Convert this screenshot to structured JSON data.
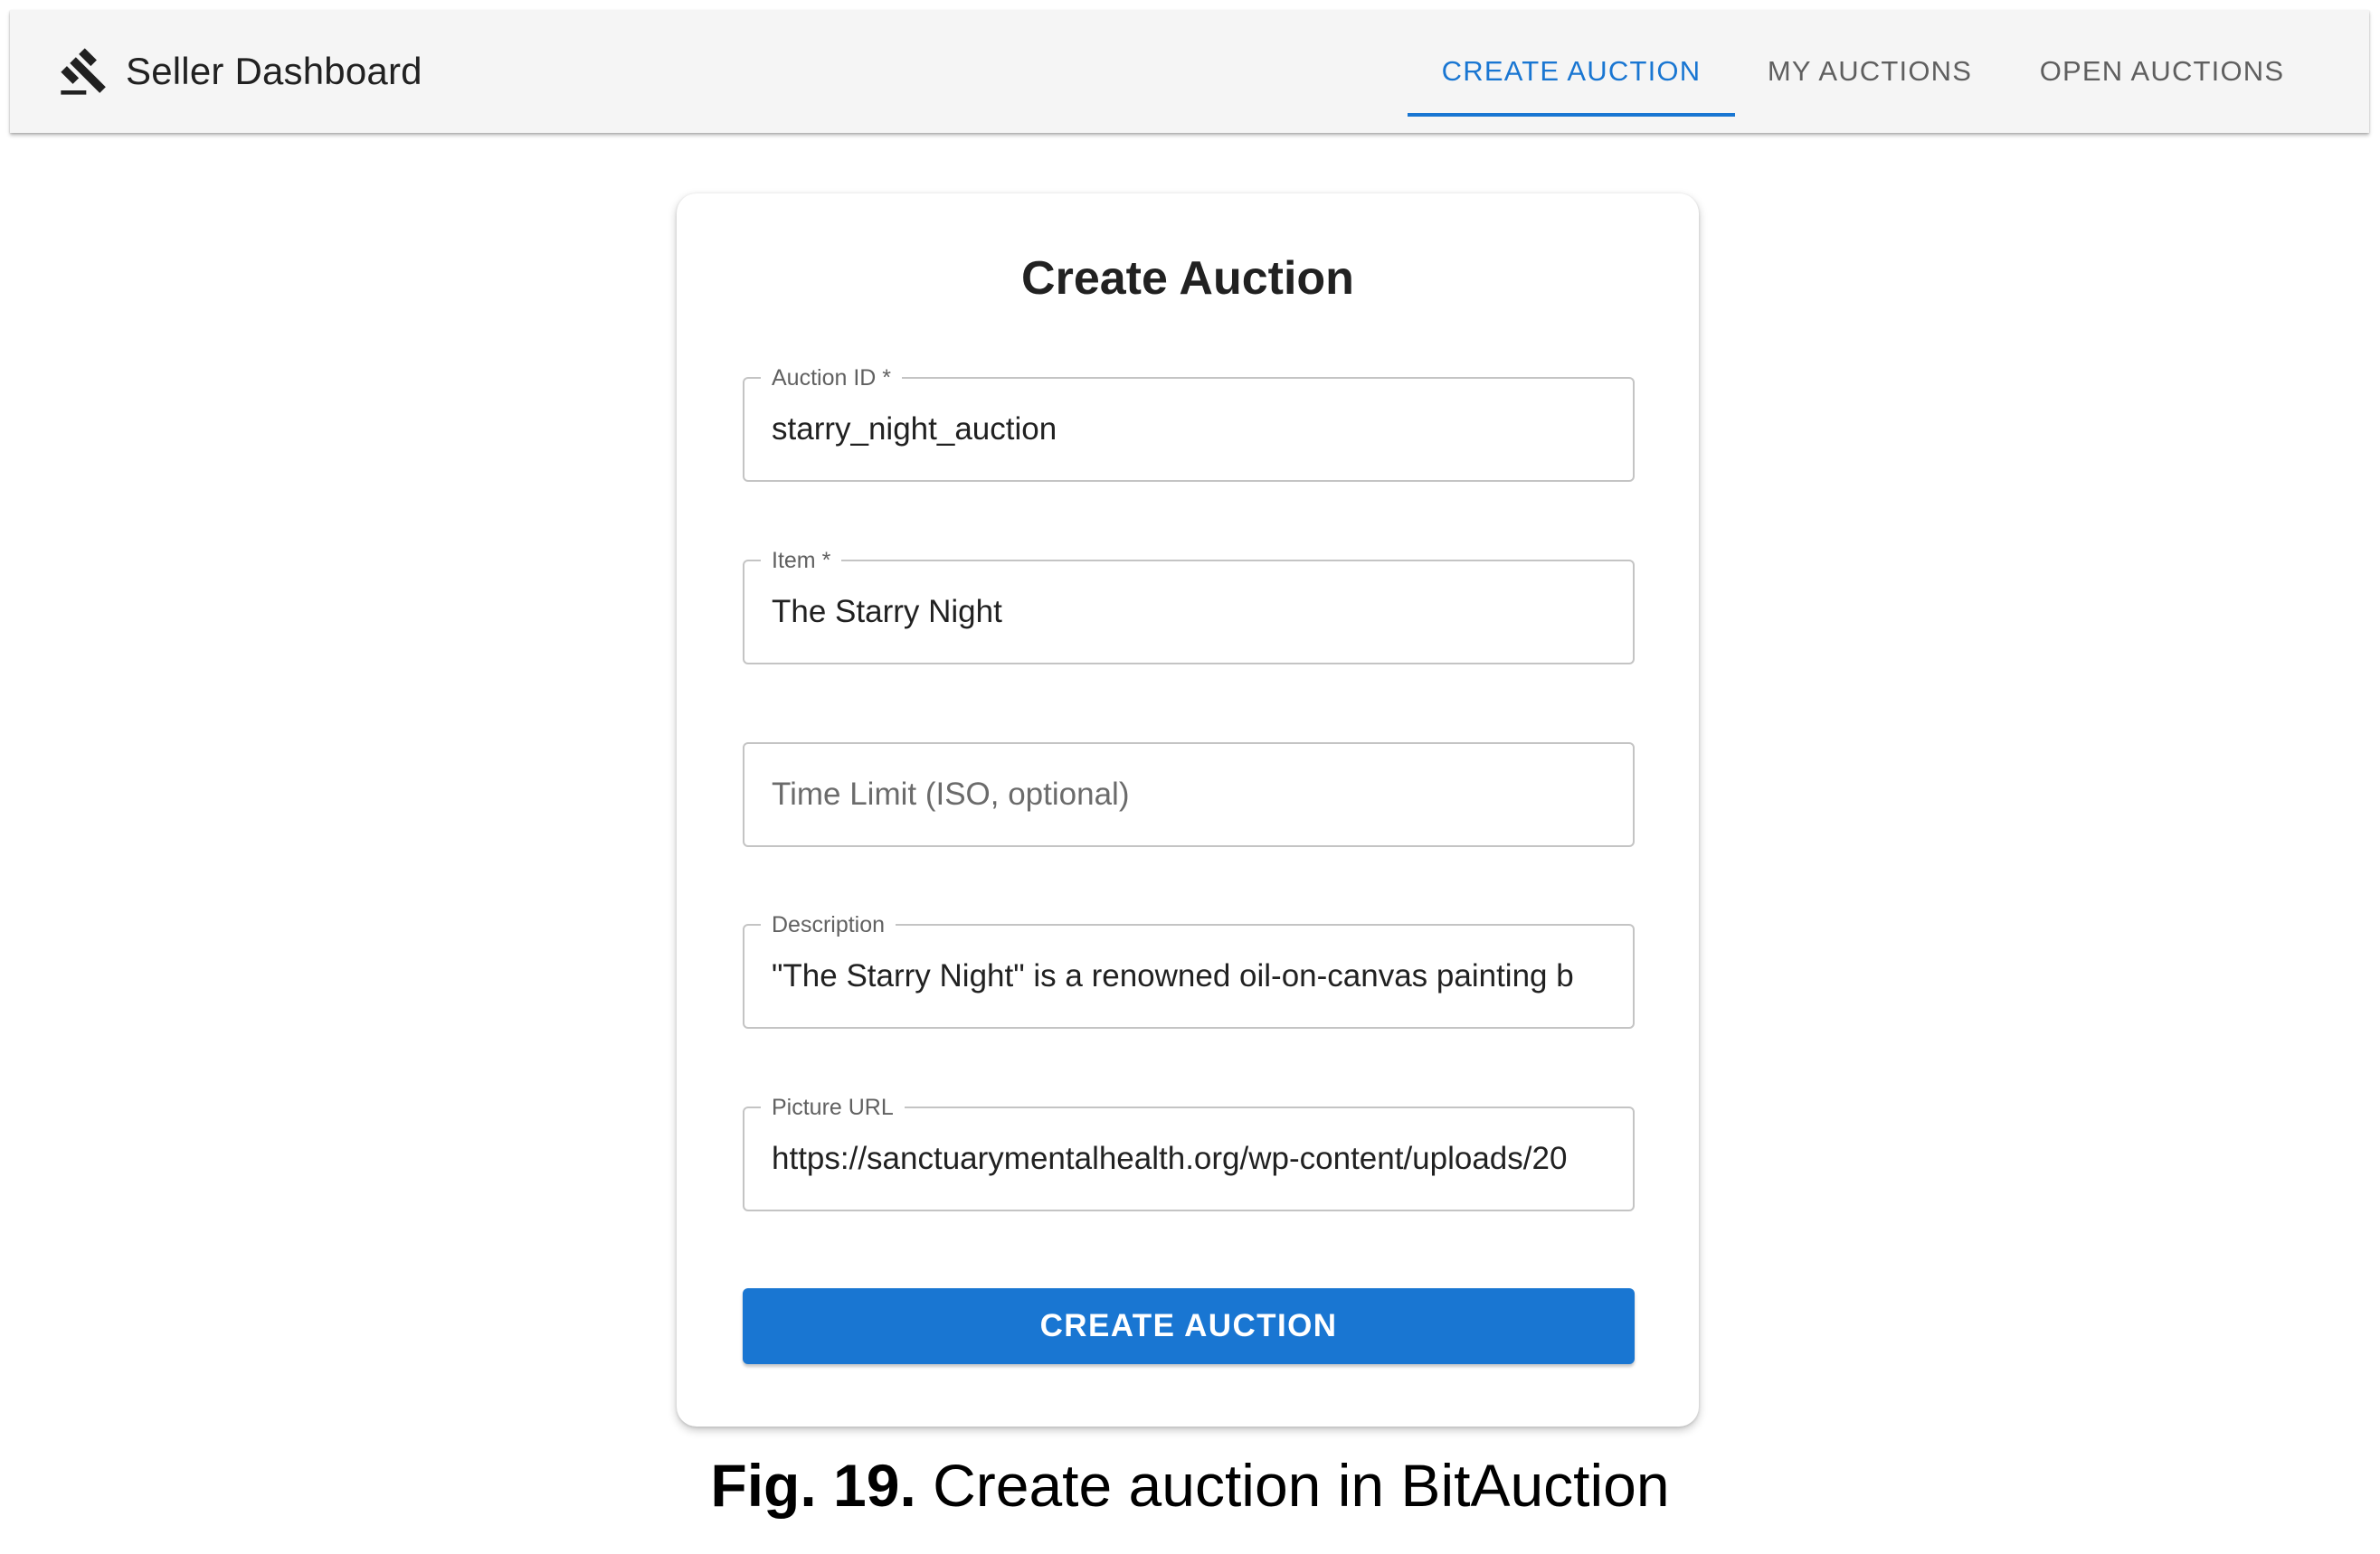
{
  "appbar": {
    "icon": "gavel-icon",
    "title": "Seller Dashboard",
    "tabs": [
      {
        "label": "CREATE AUCTION",
        "active": true
      },
      {
        "label": "MY AUCTIONS",
        "active": false
      },
      {
        "label": "OPEN AUCTIONS",
        "active": false
      }
    ]
  },
  "form": {
    "title": "Create Auction",
    "fields": {
      "auction_id": {
        "label": "Auction ID *",
        "value": "starry_night_auction"
      },
      "item": {
        "label": "Item *",
        "value": "The Starry Night"
      },
      "time_limit": {
        "placeholder": "Time Limit (ISO, optional)",
        "value": ""
      },
      "description": {
        "label": "Description",
        "value": "\"The Starry Night\" is a renowned oil-on-canvas painting b"
      },
      "picture_url": {
        "label": "Picture URL",
        "value": "https://sanctuarymentalhealth.org/wp-content/uploads/20"
      }
    },
    "submit_label": "CREATE AUCTION"
  },
  "caption": {
    "figure_label": "Fig. 19.",
    "text": "Create auction in BitAuction"
  },
  "colors": {
    "primary": "#1976d2",
    "appbar_bg": "#f5f5f5",
    "tab_inactive": "#5f5f5f"
  }
}
